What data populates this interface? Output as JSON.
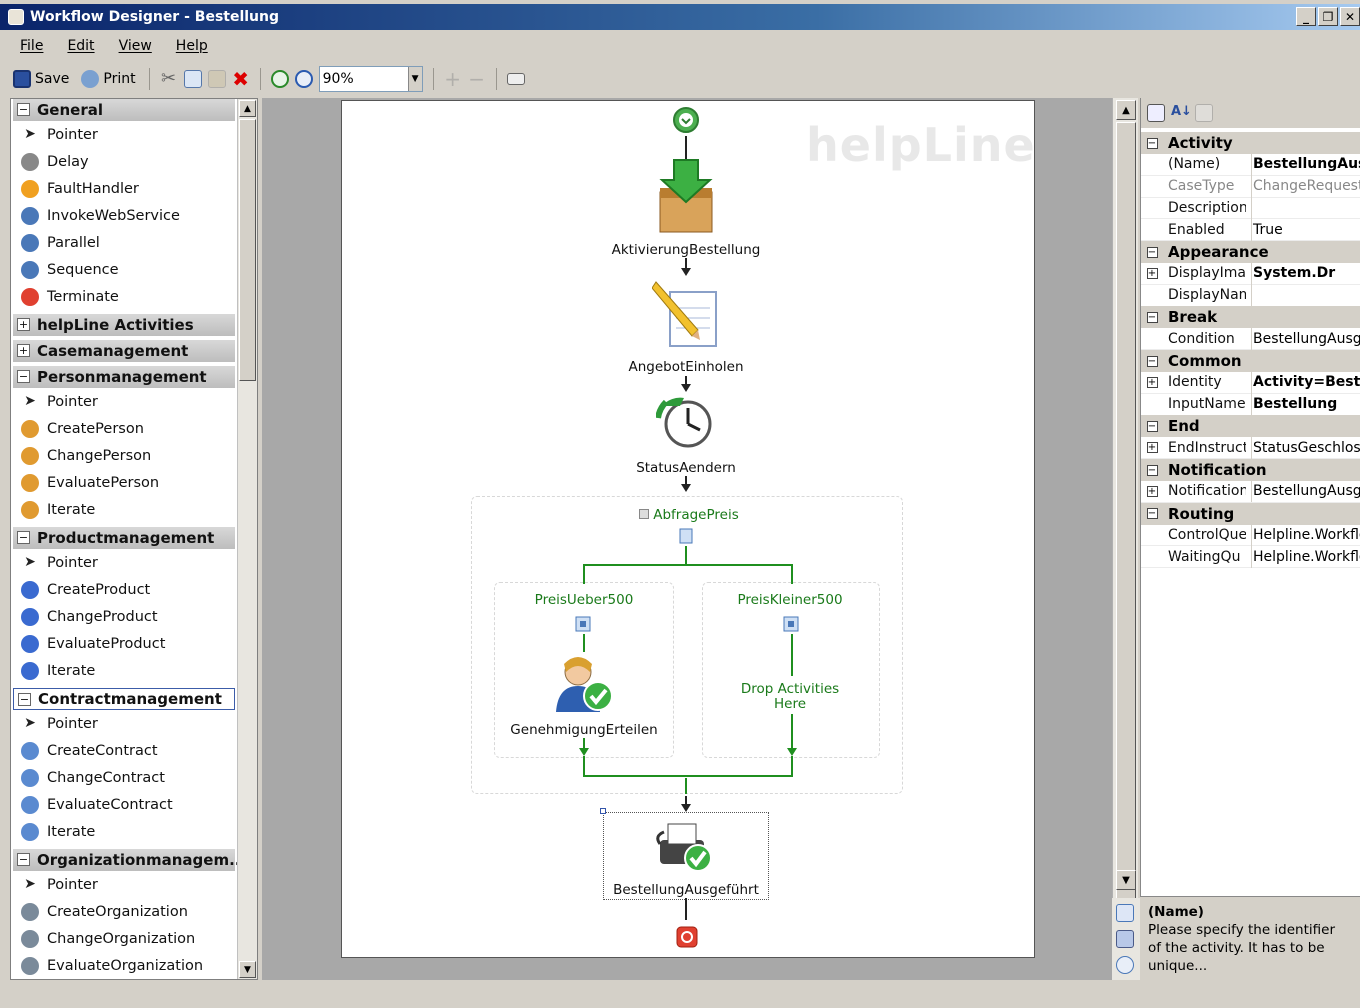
{
  "window": {
    "title": "Workflow Designer - Bestellung"
  },
  "menu": {
    "file": "File",
    "edit": "Edit",
    "view": "View",
    "help": "Help"
  },
  "toolbar": {
    "save": "Save",
    "print": "Print",
    "zoom": "90%"
  },
  "toolbox": {
    "categories": [
      {
        "name": "General",
        "expanded": true,
        "items": [
          "Pointer",
          "Delay",
          "FaultHandler",
          "InvokeWebService",
          "Parallel",
          "Sequence",
          "Terminate"
        ]
      },
      {
        "name": "helpLine Activities",
        "expanded": false,
        "items": []
      },
      {
        "name": "Casemanagement",
        "expanded": false,
        "items": []
      },
      {
        "name": "Personmanagement",
        "expanded": true,
        "items": [
          "Pointer",
          "CreatePerson",
          "ChangePerson",
          "EvaluatePerson",
          "Iterate"
        ]
      },
      {
        "name": "Productmanagement",
        "expanded": true,
        "items": [
          "Pointer",
          "CreateProduct",
          "ChangeProduct",
          "EvaluateProduct",
          "Iterate"
        ]
      },
      {
        "name": "Contractmanagement",
        "expanded": true,
        "items": [
          "Pointer",
          "CreateContract",
          "ChangeContract",
          "EvaluateContract",
          "Iterate"
        ]
      },
      {
        "name": "Organizationmanagem...",
        "expanded": true,
        "items": [
          "Pointer",
          "CreateOrganization",
          "ChangeOrganization",
          "EvaluateOrganization"
        ]
      }
    ]
  },
  "designer": {
    "watermark": "helpLine",
    "activities": {
      "a1": "AktivierungBestellung",
      "a2": "AngebotEinholen",
      "a3": "StatusAendern",
      "group": "AbfragePreis",
      "branch_left": "PreisUeber500",
      "branch_right": "PreisKleiner500",
      "left_activity": "GenehmigungErteilen",
      "drop_hint": "Drop Activities Here",
      "final": "BestellungAusgeführt"
    }
  },
  "properties": {
    "rows": [
      {
        "type": "category",
        "name": "Activity"
      },
      {
        "type": "prop",
        "name": "(Name)",
        "value": "BestellungAusg",
        "bold": true
      },
      {
        "type": "prop",
        "name": "CaseType",
        "value": "ChangeRequest",
        "grey": true
      },
      {
        "type": "prop",
        "name": "Description",
        "value": ""
      },
      {
        "type": "prop",
        "name": "Enabled",
        "value": "True"
      },
      {
        "type": "category",
        "name": "Appearance"
      },
      {
        "type": "prop",
        "name": "DisplayImag",
        "value": "System.Dr",
        "bold": true,
        "expand": true
      },
      {
        "type": "prop",
        "name": "DisplayName",
        "value": ""
      },
      {
        "type": "category",
        "name": "Break"
      },
      {
        "type": "prop",
        "name": "Condition",
        "value": "BestellungAusgef"
      },
      {
        "type": "category",
        "name": "Common"
      },
      {
        "type": "prop",
        "name": "Identity",
        "value": "Activity=Beste",
        "bold": true,
        "expand": true
      },
      {
        "type": "prop",
        "name": "InputName",
        "value": "Bestellung",
        "bold": true
      },
      {
        "type": "category",
        "name": "End"
      },
      {
        "type": "prop",
        "name": "EndInstructi",
        "value": "StatusGeschlosse",
        "expand": true
      },
      {
        "type": "category",
        "name": "Notification"
      },
      {
        "type": "prop",
        "name": "NotificationT",
        "value": "BestellungAusgef",
        "expand": true
      },
      {
        "type": "category",
        "name": "Routing"
      },
      {
        "type": "prop",
        "name": "ControlQue",
        "value": "Helpline.Workflow"
      },
      {
        "type": "prop",
        "name": "WaitingQu",
        "value": "Helpline.Workflow"
      }
    ],
    "description": {
      "title": "(Name)",
      "text": "Please specify the identifier of the activity. It has to be unique..."
    }
  }
}
